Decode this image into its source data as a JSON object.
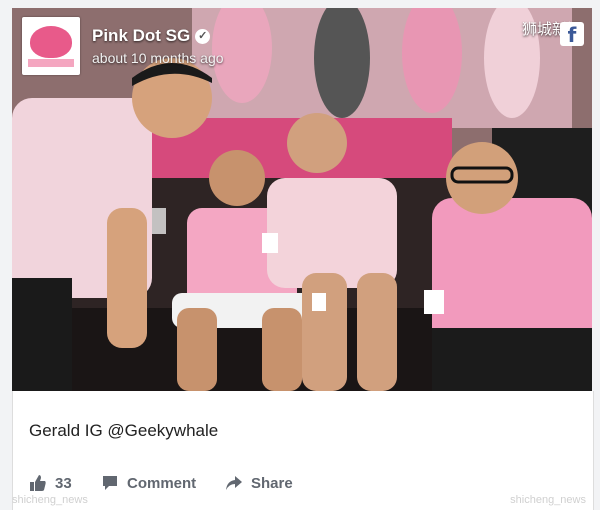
{
  "page": {
    "name": "Pink Dot SG",
    "time": "about 10 months ago"
  },
  "watermark": {
    "top": "狮城新闻",
    "bottom_left": "shicheng_news",
    "bottom_right": "shicheng_news"
  },
  "post": {
    "caption": "Gerald IG @Geekywhale"
  },
  "actions": {
    "likes": "33",
    "comment": "Comment",
    "share": "Share"
  },
  "colors": {
    "brand_pink": "#e85a8a",
    "facebook_blue": "#3b5998",
    "action_gray": "#616770"
  },
  "icons": {
    "like": "thumbs-up-icon",
    "comment": "comment-icon",
    "share": "share-icon",
    "verified": "verified-check-icon",
    "facebook": "facebook-logo-icon"
  }
}
